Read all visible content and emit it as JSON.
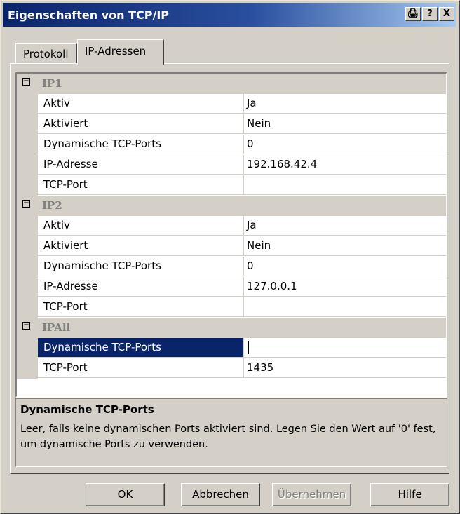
{
  "window": {
    "title": "Eigenschaften von TCP/IP",
    "controls": [
      "🖨",
      "?",
      "X"
    ]
  },
  "tabs": [
    {
      "label": "Protokoll",
      "active": false
    },
    {
      "label": "IP-Adressen",
      "active": true
    }
  ],
  "groups": [
    {
      "name": "IP1",
      "rows": [
        {
          "prop": "Aktiv",
          "value": "Ja"
        },
        {
          "prop": "Aktiviert",
          "value": "Nein"
        },
        {
          "prop": "Dynamische TCP-Ports",
          "value": "0"
        },
        {
          "prop": "IP-Adresse",
          "value": "192.168.42.4"
        },
        {
          "prop": "TCP-Port",
          "value": ""
        }
      ]
    },
    {
      "name": "IP2",
      "rows": [
        {
          "prop": "Aktiv",
          "value": "Ja"
        },
        {
          "prop": "Aktiviert",
          "value": "Nein"
        },
        {
          "prop": "Dynamische TCP-Ports",
          "value": "0"
        },
        {
          "prop": "IP-Adresse",
          "value": "127.0.0.1"
        },
        {
          "prop": "TCP-Port",
          "value": ""
        }
      ]
    },
    {
      "name": "IPAll",
      "rows": [
        {
          "prop": "Dynamische TCP-Ports",
          "value": "",
          "selected": true
        },
        {
          "prop": "TCP-Port",
          "value": "1435"
        }
      ]
    }
  ],
  "description": {
    "title": "Dynamische TCP-Ports",
    "text": "Leer, falls keine dynamischen Ports aktiviert sind. Legen Sie den Wert auf '0' fest, um dynamische Ports zu verwenden."
  },
  "buttons": [
    {
      "label": "OK",
      "enabled": true
    },
    {
      "label": "Abbrechen",
      "enabled": true
    },
    {
      "label": "Übernehmen",
      "enabled": false
    },
    {
      "label": "Hilfe",
      "enabled": true
    }
  ]
}
